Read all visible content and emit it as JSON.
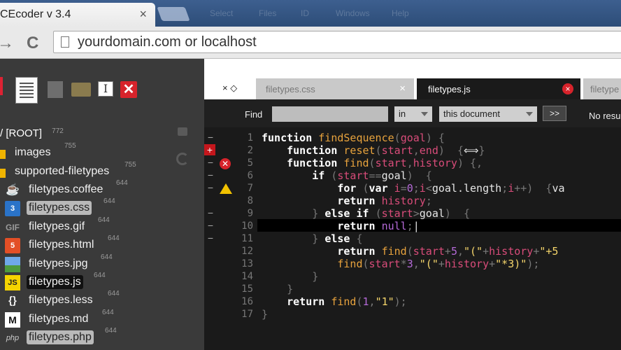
{
  "browser": {
    "tab_title": "CEcoder v 3.4",
    "tab_close": "×",
    "ghost_menu": [
      "Select",
      "Files",
      "ID",
      "Windows",
      "Help"
    ],
    "url": "yourdomain.com or localhost",
    "back": "→",
    "reload": "C"
  },
  "sidebar": {
    "root": "/ [ROOT]",
    "root_perm": "772",
    "items": [
      {
        "name": "images",
        "perm": "755",
        "icon": "folder-icon"
      },
      {
        "name": "supported-filetypes",
        "perm": "755",
        "icon": "folder-icon"
      },
      {
        "name": "filetypes.coffee",
        "perm": "644",
        "icon": "coffee-icon"
      },
      {
        "name": "filetypes.css",
        "perm": "644",
        "icon": "css3-icon"
      },
      {
        "name": "filetypes.gif",
        "perm": "644",
        "icon": "gif-icon"
      },
      {
        "name": "filetypes.html",
        "perm": "644",
        "icon": "html5-icon"
      },
      {
        "name": "filetypes.jpg",
        "perm": "644",
        "icon": "image-icon"
      },
      {
        "name": "filetypes.js",
        "perm": "644",
        "icon": "js-icon"
      },
      {
        "name": "filetypes.less",
        "perm": "644",
        "icon": "less-icon"
      },
      {
        "name": "filetypes.md",
        "perm": "644",
        "icon": "markdown-icon"
      },
      {
        "name": "filetypes.php",
        "perm": "644",
        "icon": "php-icon"
      }
    ],
    "icon_labels": {
      "css": "3",
      "gif": "GIF",
      "html": "5",
      "js": "JS",
      "less": "{}",
      "md": "M",
      "php": "php"
    }
  },
  "editor": {
    "tabs": [
      {
        "label": "filetypes.css",
        "close": "×"
      },
      {
        "label": "filetypes.js",
        "close": "×"
      },
      {
        "label": "filetype"
      }
    ],
    "tab_arrows": "×  ◇",
    "find": {
      "label": "Find",
      "in_value": "in",
      "scope_value": "this document",
      "next_label": ">>",
      "status": "No resu"
    },
    "fold_markers": [
      "−",
      "+",
      "−",
      "−",
      "−",
      "−",
      "−",
      "−"
    ],
    "line_numbers": [
      "1",
      "2",
      "5",
      "6",
      "7",
      "8",
      "9",
      "10",
      "11",
      "12",
      "13",
      "14",
      "15",
      "16",
      "17"
    ],
    "code_lines": [
      [
        [
          "k",
          "function "
        ],
        [
          "f",
          "findSequence"
        ],
        [
          "p",
          "("
        ],
        [
          "v",
          "goal"
        ],
        [
          "p",
          ") {"
        ]
      ],
      [
        [
          "k",
          "    function "
        ],
        [
          "f",
          "reset"
        ],
        [
          "p",
          "("
        ],
        [
          "v",
          "start"
        ],
        [
          "p",
          ","
        ],
        [
          "v",
          "end"
        ],
        [
          "p",
          ")  {"
        ],
        [
          "d",
          "⟺"
        ],
        [
          "p",
          "}"
        ]
      ],
      [
        [
          "k",
          "    function "
        ],
        [
          "f",
          "find"
        ],
        [
          "p",
          "("
        ],
        [
          "v",
          "start"
        ],
        [
          "p",
          ","
        ],
        [
          "v",
          "history"
        ],
        [
          "p",
          ") {,"
        ]
      ],
      [
        [
          "k",
          "        if "
        ],
        [
          "p",
          "("
        ],
        [
          "v",
          "start"
        ],
        [
          "p",
          "=="
        ],
        [
          "d",
          "goal"
        ],
        [
          "p",
          ")  {"
        ]
      ],
      [
        [
          "k",
          "            for "
        ],
        [
          "p",
          "("
        ],
        [
          "k",
          "var "
        ],
        [
          "v",
          "i"
        ],
        [
          "p",
          "="
        ],
        [
          "n",
          "0"
        ],
        [
          "p",
          ";"
        ],
        [
          "v",
          "i"
        ],
        [
          "p",
          "<"
        ],
        [
          "d",
          "goal.length"
        ],
        [
          "p",
          ";"
        ],
        [
          "v",
          "i"
        ],
        [
          "p",
          "++)  {"
        ],
        [
          "d",
          "va"
        ]
      ],
      [
        [
          "k",
          "            return "
        ],
        [
          "v",
          "history"
        ],
        [
          "p",
          ";"
        ]
      ],
      [
        [
          "p",
          "        } "
        ],
        [
          "k",
          "else if "
        ],
        [
          "p",
          "("
        ],
        [
          "v",
          "start"
        ],
        [
          "p",
          ">"
        ],
        [
          "d",
          "goal"
        ],
        [
          "p",
          ")  {"
        ]
      ],
      [
        [
          "k",
          "            return "
        ],
        [
          "n",
          "null"
        ],
        [
          "p",
          ";"
        ],
        [
          "d",
          "|"
        ]
      ],
      [
        [
          "p",
          "        } "
        ],
        [
          "k",
          "else "
        ],
        [
          "p",
          "{"
        ]
      ],
      [
        [
          "k",
          "            return "
        ],
        [
          "f",
          "find"
        ],
        [
          "p",
          "("
        ],
        [
          "v",
          "start"
        ],
        [
          "p",
          "+"
        ],
        [
          "n",
          "5"
        ],
        [
          "p",
          ","
        ],
        [
          "s",
          "\"(\""
        ],
        [
          "p",
          "+"
        ],
        [
          "v",
          "history"
        ],
        [
          "p",
          "+"
        ],
        [
          "s",
          "\"+5"
        ]
      ],
      [
        [
          "f",
          "            find"
        ],
        [
          "p",
          "("
        ],
        [
          "v",
          "start"
        ],
        [
          "p",
          "*"
        ],
        [
          "n",
          "3"
        ],
        [
          "p",
          ","
        ],
        [
          "s",
          "\"(\""
        ],
        [
          "p",
          "+"
        ],
        [
          "v",
          "history"
        ],
        [
          "p",
          "+"
        ],
        [
          "s",
          "\"*3)\""
        ],
        [
          "p",
          ");"
        ]
      ],
      [
        [
          "p",
          "        }"
        ]
      ],
      [
        [
          "p",
          "    }"
        ]
      ],
      [
        [
          "k",
          "    return "
        ],
        [
          "f",
          "find"
        ],
        [
          "p",
          "("
        ],
        [
          "n",
          "1"
        ],
        [
          "p",
          ","
        ],
        [
          "s",
          "\"1\""
        ],
        [
          "p",
          ");"
        ]
      ],
      [
        [
          "p",
          "}"
        ]
      ]
    ]
  },
  "colors": {
    "accent_red": "#d7232b",
    "warning": "#f2c200",
    "folder": "#f0b400"
  }
}
